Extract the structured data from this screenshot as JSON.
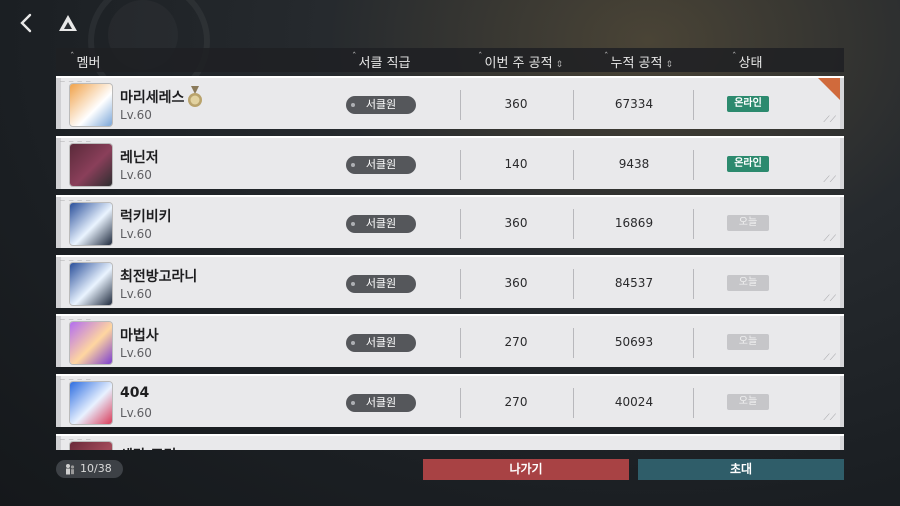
{
  "header": {
    "member": "멤버",
    "rank": "서클 직급",
    "weekly": "이번 주 공적",
    "total": "누적 공적",
    "status": "상태"
  },
  "members": [
    {
      "name": "마리세레스",
      "level": "Lv.60",
      "rank": "서클원",
      "weekly": "360",
      "total": "67334",
      "status": "온라인",
      "online": true,
      "has_medal": true,
      "leader": true
    },
    {
      "name": "레닌저",
      "level": "Lv.60",
      "rank": "서클원",
      "weekly": "140",
      "total": "9438",
      "status": "온라인",
      "online": true
    },
    {
      "name": "럭키비키",
      "level": "Lv.60",
      "rank": "서클원",
      "weekly": "360",
      "total": "16869",
      "status": "오늘",
      "online": false
    },
    {
      "name": "최전방고라니",
      "level": "Lv.60",
      "rank": "서클원",
      "weekly": "360",
      "total": "84537",
      "status": "오늘",
      "online": false
    },
    {
      "name": "마법사",
      "level": "Lv.60",
      "rank": "서클원",
      "weekly": "270",
      "total": "50693",
      "status": "오늘",
      "online": false
    },
    {
      "name": "404",
      "level": "Lv.60",
      "rank": "서클원",
      "weekly": "270",
      "total": "40024",
      "status": "오늘",
      "online": false
    },
    {
      "name": "세라 주리",
      "level": "",
      "rank": "",
      "weekly": "",
      "total": "",
      "status": "",
      "online": false
    }
  ],
  "footer": {
    "member_count": "10/38",
    "leave_label": "나가기",
    "invite_label": "초대"
  },
  "colors": {
    "online": "#2c8a6e",
    "leave": "#a84244",
    "invite": "#2f5d69",
    "leader_corner": "#d06a3c"
  }
}
